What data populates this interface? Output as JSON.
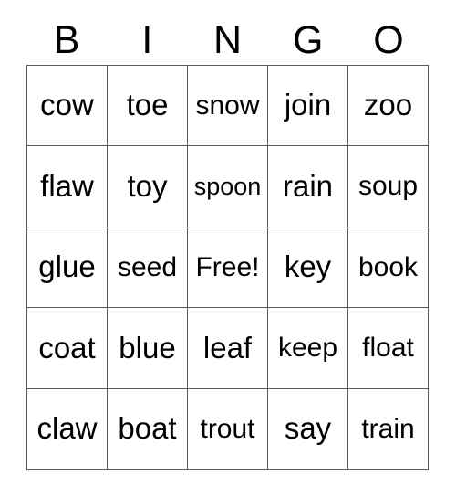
{
  "card": {
    "title": "BINGO",
    "headers": [
      "B",
      "I",
      "N",
      "G",
      "O"
    ],
    "free_space_label": "Free!",
    "colors": {
      "border": "#595959",
      "cell_background": "#ffffff",
      "text": "#000000",
      "page_background": "#ffffff"
    },
    "rows": [
      [
        {
          "text": "cow",
          "fit": ""
        },
        {
          "text": "toe",
          "fit": ""
        },
        {
          "text": "snow",
          "fit": "fit-sm"
        },
        {
          "text": "join",
          "fit": ""
        },
        {
          "text": "zoo",
          "fit": ""
        }
      ],
      [
        {
          "text": "flaw",
          "fit": ""
        },
        {
          "text": "toy",
          "fit": ""
        },
        {
          "text": "spoon",
          "fit": "fit-xs"
        },
        {
          "text": "rain",
          "fit": ""
        },
        {
          "text": "soup",
          "fit": "fit-sm"
        }
      ],
      [
        {
          "text": "glue",
          "fit": ""
        },
        {
          "text": "seed",
          "fit": "fit-sm"
        },
        {
          "text": "Free!",
          "fit": "fit-sm"
        },
        {
          "text": "key",
          "fit": ""
        },
        {
          "text": "book",
          "fit": "fit-sm"
        }
      ],
      [
        {
          "text": "coat",
          "fit": ""
        },
        {
          "text": "blue",
          "fit": ""
        },
        {
          "text": "leaf",
          "fit": ""
        },
        {
          "text": "keep",
          "fit": "fit-sm"
        },
        {
          "text": "float",
          "fit": "fit-sm"
        }
      ],
      [
        {
          "text": "claw",
          "fit": ""
        },
        {
          "text": "boat",
          "fit": ""
        },
        {
          "text": "trout",
          "fit": "fit-sm"
        },
        {
          "text": "say",
          "fit": ""
        },
        {
          "text": "train",
          "fit": "fit-sm"
        }
      ]
    ]
  }
}
